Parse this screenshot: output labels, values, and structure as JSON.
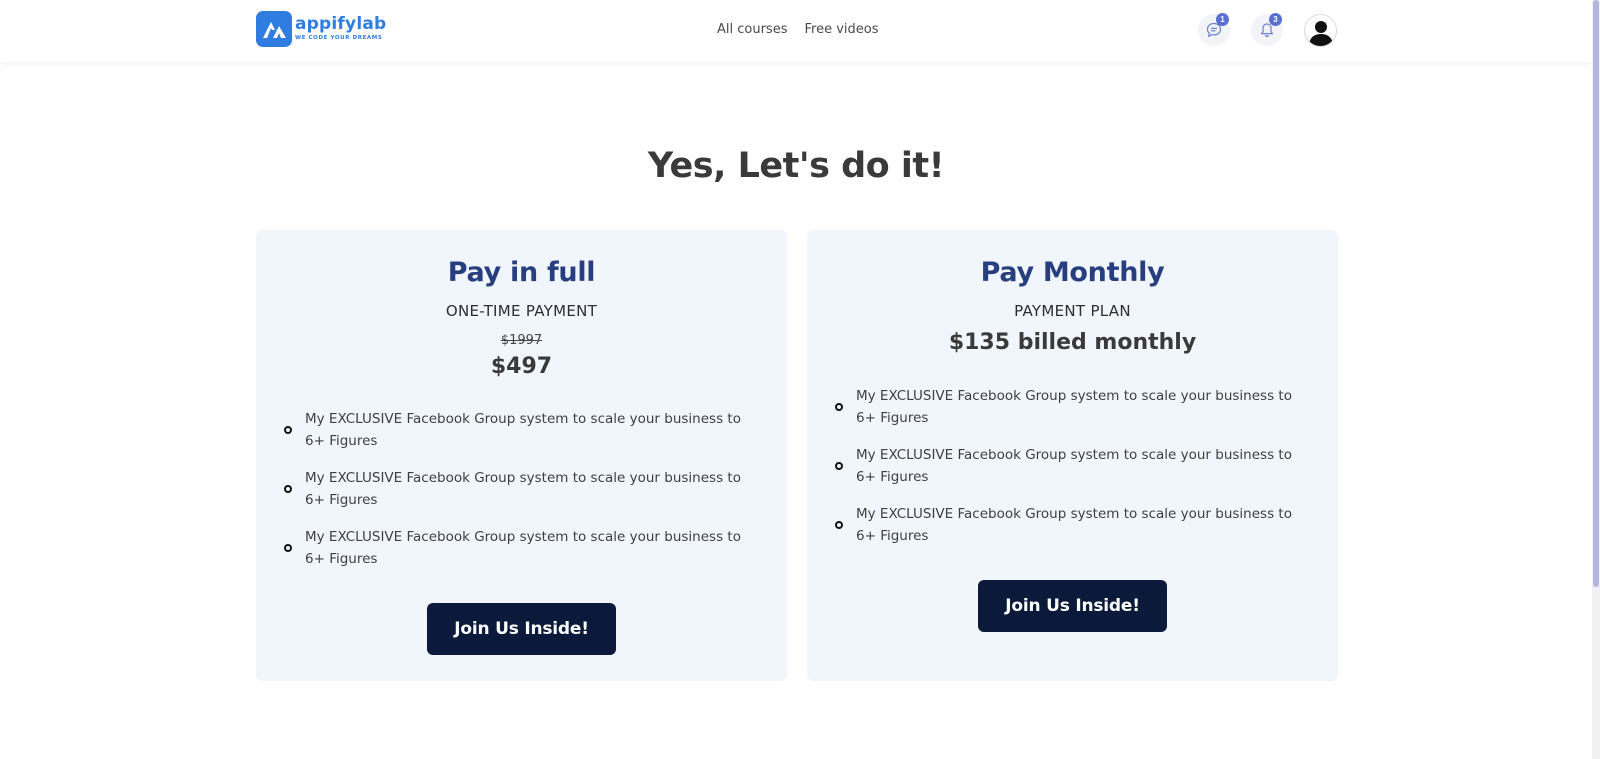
{
  "header": {
    "logo": {
      "name": "appifylab",
      "tagline": "WE CODE YOUR DREAMS"
    },
    "nav": [
      "All courses",
      "Free videos"
    ],
    "messages_icon": "chat-icon",
    "messages_badge": "1",
    "notifications_icon": "bell-icon",
    "notifications_badge": "3",
    "avatar_icon": "user-icon"
  },
  "page": {
    "title": "Yes, Let's do it!"
  },
  "plans": [
    {
      "title": "Pay in full",
      "subtitle": "ONE-TIME PAYMENT",
      "old_price": "$1997",
      "price": "$497",
      "features": [
        "My EXCLUSIVE Facebook Group system to scale your business to 6+ Figures",
        "My EXCLUSIVE Facebook Group system to scale your business to 6+ Figures",
        "My EXCLUSIVE Facebook Group system to scale your business to 6+ Figures"
      ],
      "cta": "Join Us Inside!"
    },
    {
      "title": "Pay Monthly",
      "subtitle": "PAYMENT PLAN",
      "price": "$135 billed monthly",
      "features": [
        "My EXCLUSIVE Facebook Group system to scale your business to 6+ Figures",
        "My EXCLUSIVE Facebook Group system to scale your business to 6+ Figures",
        "My EXCLUSIVE Facebook Group system to scale your business to 6+ Figures"
      ],
      "cta": "Join Us Inside!"
    }
  ],
  "colors": {
    "brand": "#2f7de1",
    "card_bg": "#f1f6fd",
    "plan_title": "#273f7f",
    "cta_bg": "#0b1a3a",
    "badge": "#5a6fd6"
  }
}
